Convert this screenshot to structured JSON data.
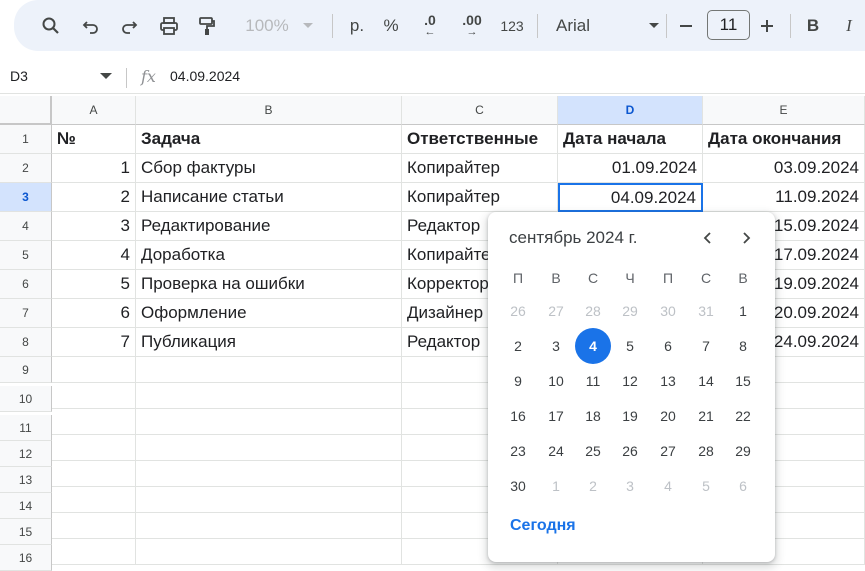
{
  "toolbar": {
    "zoom": "100%",
    "currency": "р.",
    "percent": "%",
    "dec_decrease": ".0",
    "dec_increase": ".00",
    "format_123": "123",
    "font": "Arial",
    "font_size": "11",
    "bold": "B",
    "italic": "I"
  },
  "formula_bar": {
    "cell_ref": "D3",
    "fx": "fx",
    "value": "04.09.2024"
  },
  "sheet": {
    "columns": [
      "A",
      "B",
      "C",
      "D",
      "E"
    ],
    "rows": [
      "1",
      "2",
      "3",
      "4",
      "5",
      "6",
      "7",
      "8",
      "9",
      "10",
      "11",
      "12",
      "13",
      "14",
      "15",
      "16"
    ],
    "header_row": {
      "A": "№",
      "B": "Задача",
      "C": "Ответственные",
      "D": "Дата начала",
      "E": "Дата окончания"
    },
    "data_rows": [
      {
        "A": "1",
        "B": "Сбор фактуры",
        "C": "Копирайтер",
        "D": "01.09.2024",
        "E": "03.09.2024"
      },
      {
        "A": "2",
        "B": "Написание статьи",
        "C": "Копирайтер",
        "D": "04.09.2024",
        "E": "11.09.2024"
      },
      {
        "A": "3",
        "B": "Редактирование",
        "C": "Редактор",
        "D": "",
        "E": "15.09.2024"
      },
      {
        "A": "4",
        "B": "Доработка",
        "C": "Копирайтер",
        "D": "",
        "E": "17.09.2024"
      },
      {
        "A": "5",
        "B": "Проверка на ошибки",
        "C": "Корректор",
        "D": "",
        "E": "19.09.2024"
      },
      {
        "A": "6",
        "B": "Оформление",
        "C": "Дизайнер",
        "D": "",
        "E": "20.09.2024"
      },
      {
        "A": "7",
        "B": "Публикация",
        "C": "Редактор",
        "D": "",
        "E": "24.09.2024"
      }
    ]
  },
  "datepicker": {
    "month_title": "сентябрь 2024 г.",
    "weekdays": [
      "П",
      "В",
      "С",
      "Ч",
      "П",
      "С",
      "В"
    ],
    "weeks": [
      [
        "26",
        "27",
        "28",
        "29",
        "30",
        "31",
        "1"
      ],
      [
        "2",
        "3",
        "4",
        "5",
        "6",
        "7",
        "8"
      ],
      [
        "9",
        "10",
        "11",
        "12",
        "13",
        "14",
        "15"
      ],
      [
        "16",
        "17",
        "18",
        "19",
        "20",
        "21",
        "22"
      ],
      [
        "23",
        "24",
        "25",
        "26",
        "27",
        "28",
        "29"
      ],
      [
        "30",
        "1",
        "2",
        "3",
        "4",
        "5",
        "6"
      ]
    ],
    "selected_day": "4",
    "today_label": "Сегодня",
    "accent_color": "#1a73e8"
  }
}
